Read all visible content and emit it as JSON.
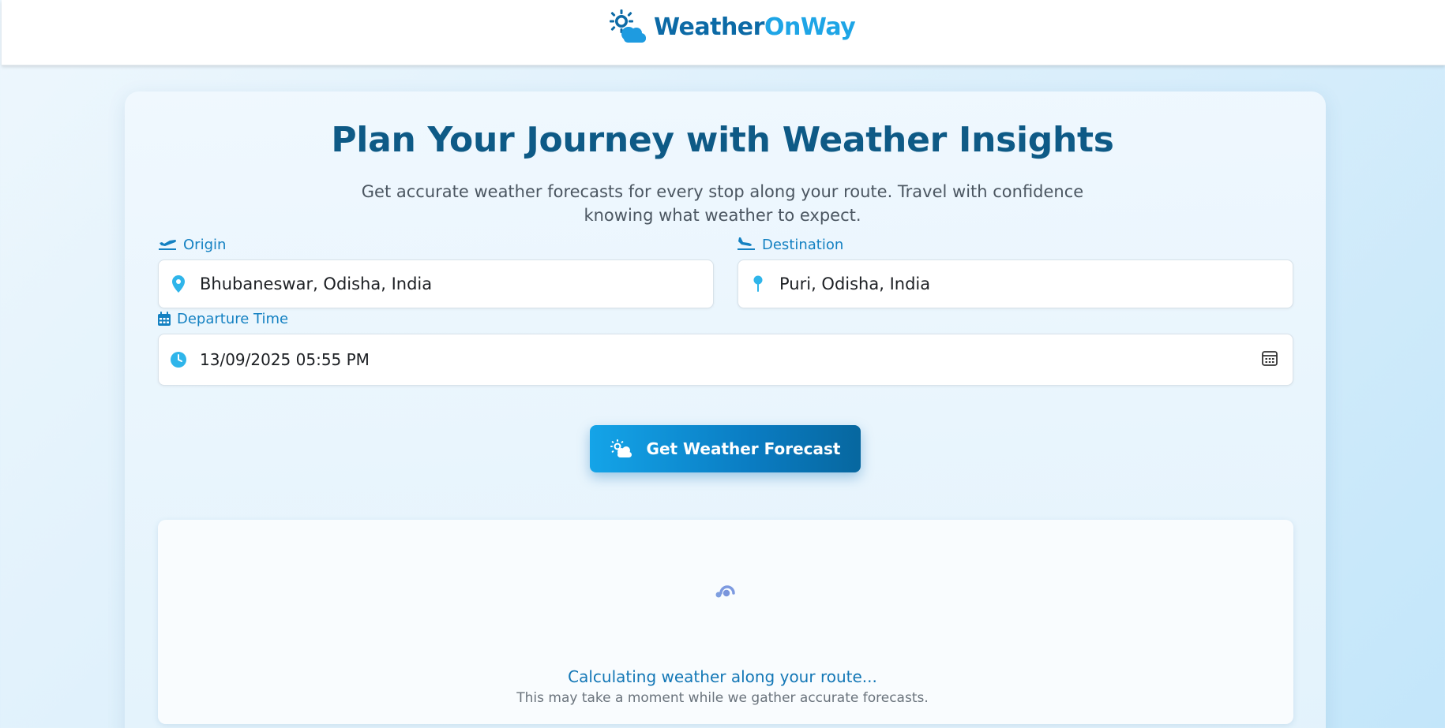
{
  "header": {
    "brand_part1": "Weather",
    "brand_part2": "OnWay",
    "logo_icon": "sun-cloud-icon"
  },
  "hero": {
    "title": "Plan Your Journey with Weather Insights",
    "subtitle": "Get accurate weather forecasts for every stop along your route. Travel with confidence knowing what weather to expect."
  },
  "form": {
    "origin": {
      "label": "Origin",
      "label_icon": "plane-departure-icon",
      "value": "Bhubaneswar, Odisha, India",
      "field_icon": "map-marker-icon"
    },
    "destination": {
      "label": "Destination",
      "label_icon": "plane-arrival-icon",
      "value": "Puri, Odisha, India",
      "field_icon": "map-pin-icon"
    },
    "departure": {
      "label": "Departure Time",
      "label_icon": "calendar-icon",
      "value": "13/09/2025 05:55 PM",
      "field_icon": "clock-icon",
      "picker_icon": "calendar-picker-icon"
    },
    "submit_label": "Get Weather Forecast",
    "submit_icon": "sun-cloud-icon"
  },
  "loading": {
    "title": "Calculating weather along your route...",
    "subtitle": "This may take a moment while we gather accurate forecasts."
  },
  "colors": {
    "brand_dark": "#0c6aa6",
    "brand_light": "#1ea5e6",
    "title": "#0e5a86",
    "label": "#1481c2",
    "accent_icon": "#2fb5ea"
  }
}
